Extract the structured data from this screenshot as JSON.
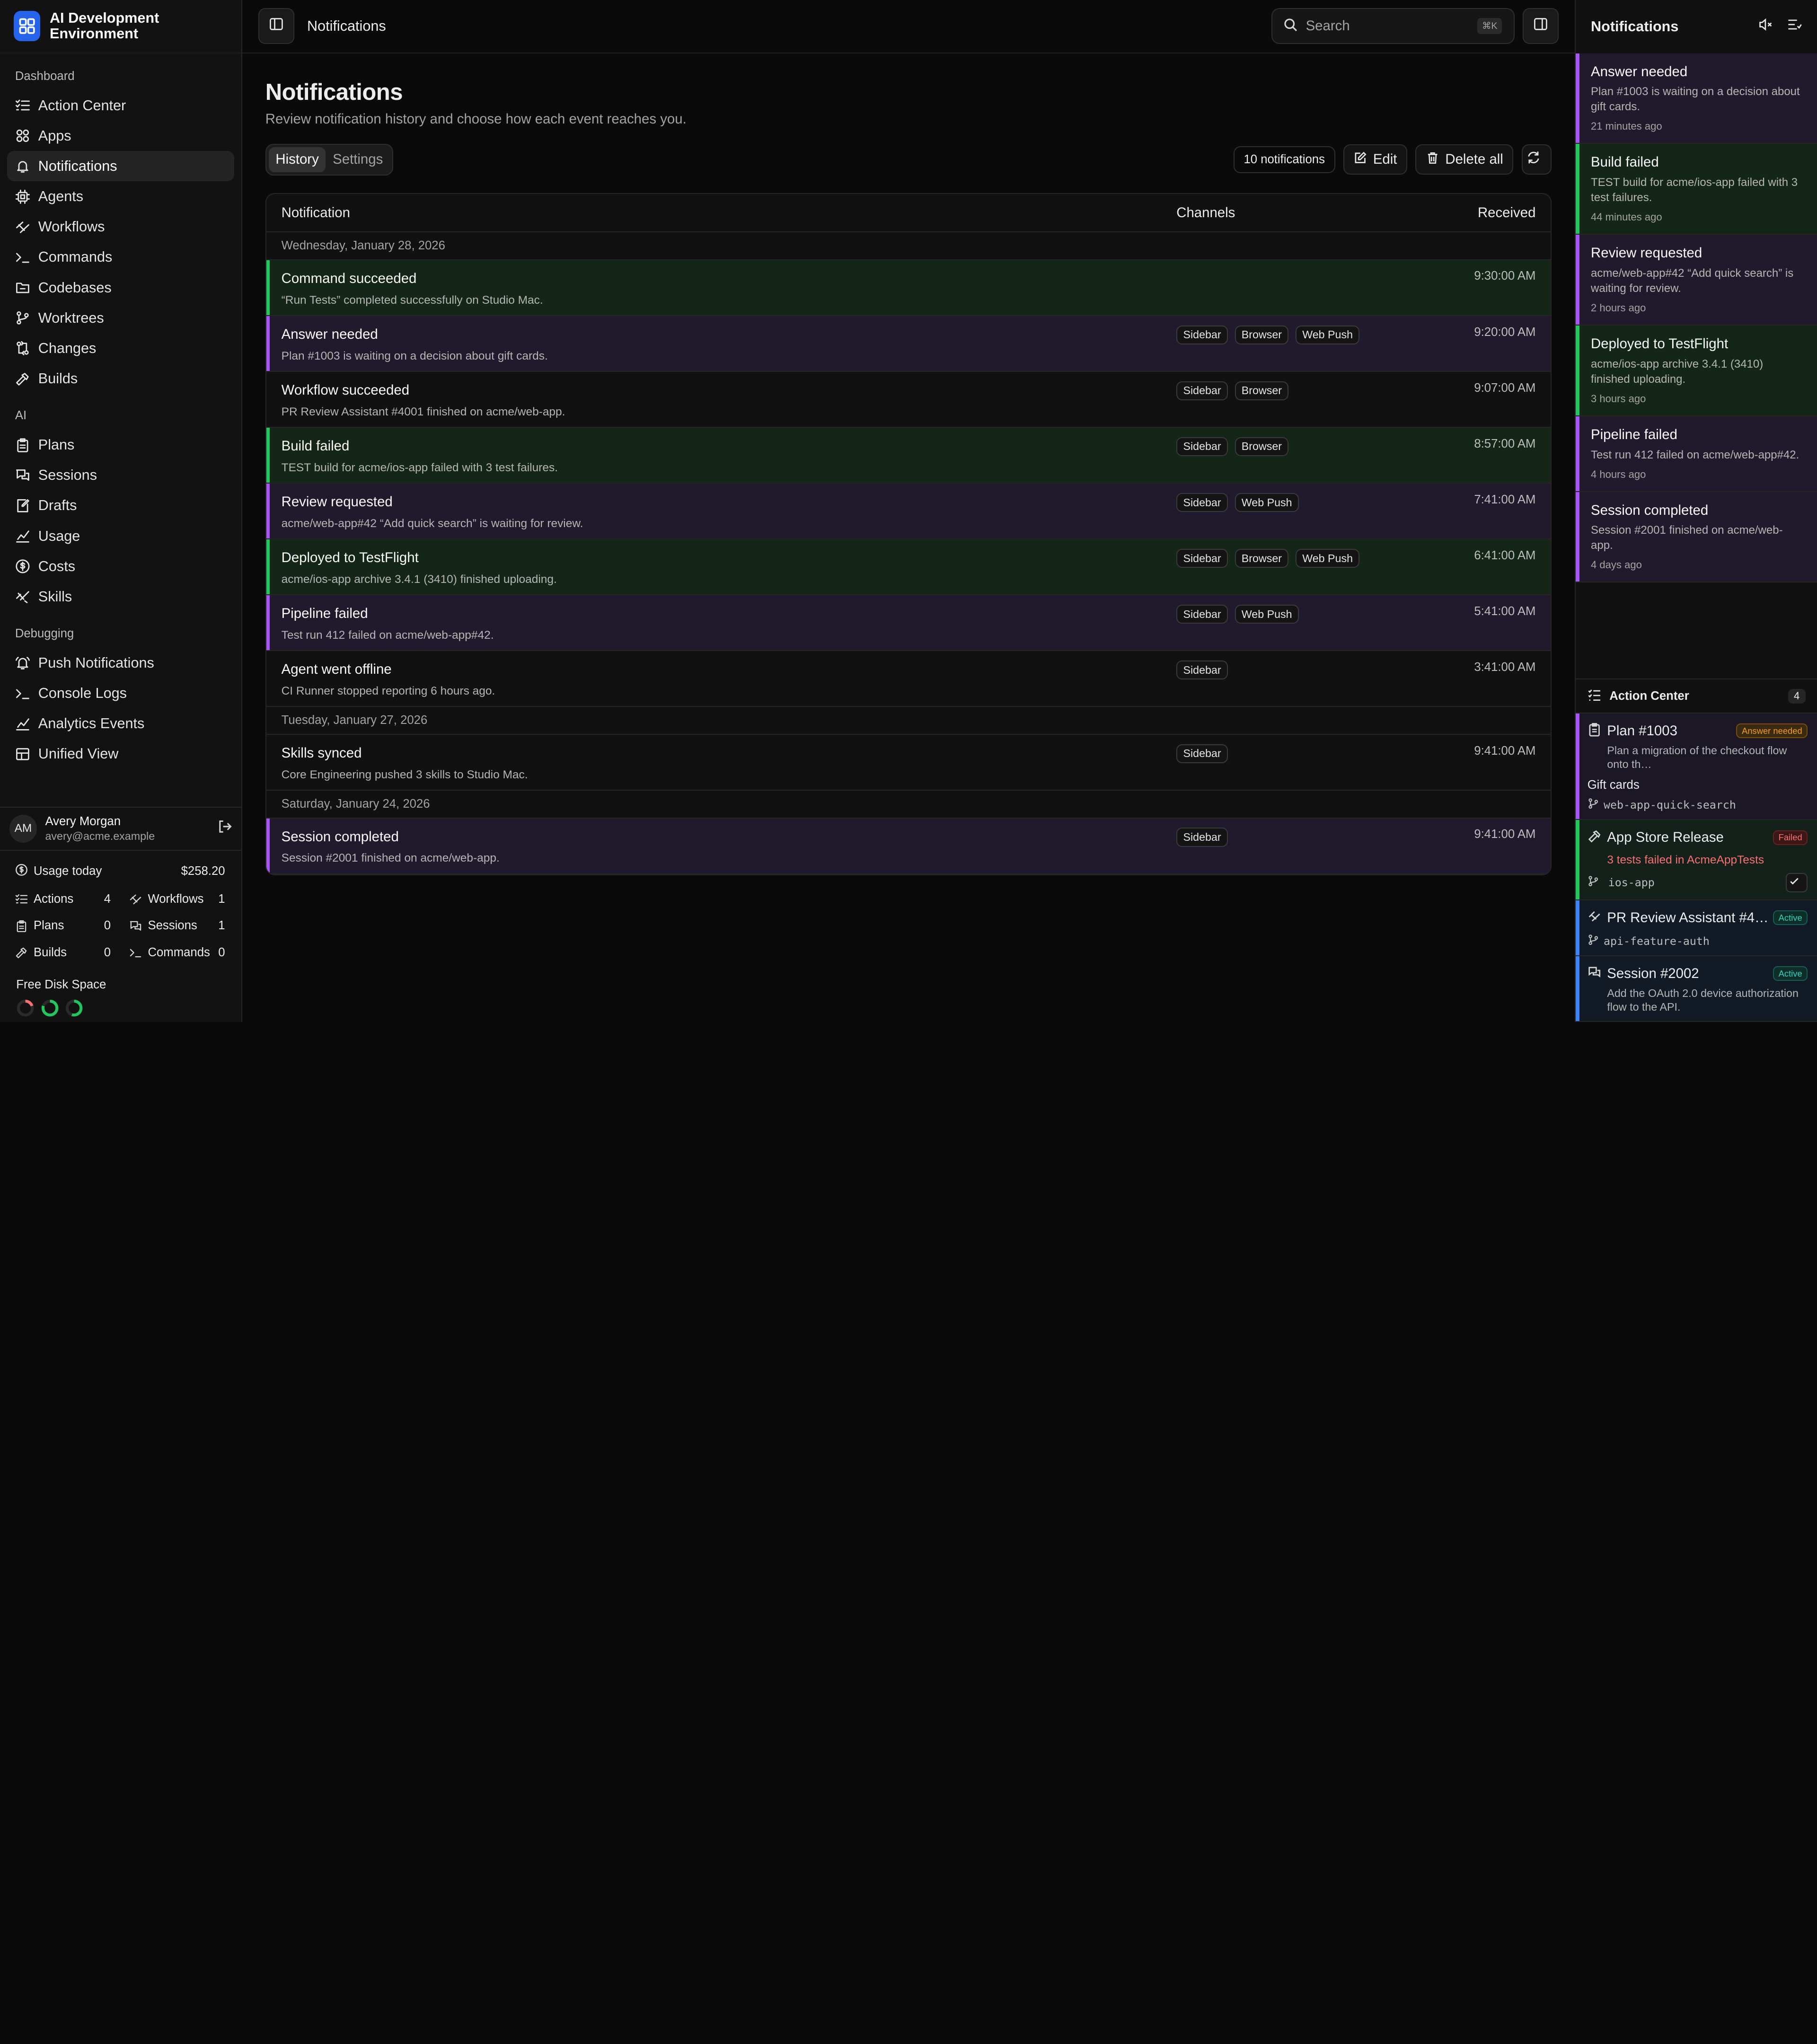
{
  "app": {
    "name": "AI Development Environment"
  },
  "sidebar": {
    "sections": [
      {
        "title": "Dashboard",
        "items": [
          {
            "label": "Action Center",
            "icon": "list-check-icon"
          },
          {
            "label": "Apps",
            "icon": "apps-icon"
          },
          {
            "label": "Notifications",
            "icon": "bell-icon",
            "active": true
          },
          {
            "label": "Agents",
            "icon": "cpu-icon"
          },
          {
            "label": "Workflows",
            "icon": "workflow-icon"
          },
          {
            "label": "Commands",
            "icon": "terminal-icon"
          },
          {
            "label": "Codebases",
            "icon": "folder-icon"
          },
          {
            "label": "Worktrees",
            "icon": "branch-icon"
          },
          {
            "label": "Changes",
            "icon": "diff-icon"
          },
          {
            "label": "Builds",
            "icon": "hammer-icon"
          }
        ]
      },
      {
        "title": "AI",
        "items": [
          {
            "label": "Plans",
            "icon": "clipboard-icon"
          },
          {
            "label": "Sessions",
            "icon": "chat-icon"
          },
          {
            "label": "Drafts",
            "icon": "draft-icon"
          },
          {
            "label": "Usage",
            "icon": "chart-icon"
          },
          {
            "label": "Costs",
            "icon": "dollar-icon"
          },
          {
            "label": "Skills",
            "icon": "sparkle-icon"
          }
        ]
      },
      {
        "title": "Debugging",
        "items": [
          {
            "label": "Push Notifications",
            "icon": "bell-ring-icon"
          },
          {
            "label": "Console Logs",
            "icon": "terminal-icon"
          },
          {
            "label": "Analytics Events",
            "icon": "chart-icon"
          },
          {
            "label": "Unified View",
            "icon": "layout-icon"
          }
        ]
      }
    ],
    "user": {
      "initials": "AM",
      "name": "Avery Morgan",
      "email": "avery@acme.example"
    },
    "usage": {
      "label": "Usage today",
      "value": "$258.20"
    },
    "stats": [
      {
        "label": "Actions",
        "value": "4",
        "icon": "list-check-icon"
      },
      {
        "label": "Workflows",
        "value": "1",
        "icon": "workflow-icon"
      },
      {
        "label": "Plans",
        "value": "0",
        "icon": "clipboard-icon"
      },
      {
        "label": "Sessions",
        "value": "1",
        "icon": "chat-icon"
      },
      {
        "label": "Builds",
        "value": "0",
        "icon": "hammer-icon"
      },
      {
        "label": "Commands",
        "value": "0",
        "icon": "terminal-icon"
      }
    ],
    "disk": {
      "title": "Free Disk Space",
      "rings": [
        {
          "color": "#f87171",
          "fraction": 0.2
        },
        {
          "color": "#22c55e",
          "fraction": 0.8
        },
        {
          "color": "#22c55e",
          "fraction": 0.55
        }
      ]
    }
  },
  "topbar": {
    "title": "Notifications",
    "search_placeholder": "Search",
    "shortcut": "⌘K"
  },
  "page": {
    "title": "Notifications",
    "subtitle": "Review notification history and choose how each event reaches you.",
    "tabs": [
      {
        "label": "History",
        "active": true
      },
      {
        "label": "Settings",
        "active": false
      }
    ],
    "count": "10 notifications",
    "edit_label": "Edit",
    "delete_label": "Delete all"
  },
  "table": {
    "headers": {
      "notification": "Notification",
      "channels": "Channels",
      "received": "Received"
    },
    "groups": [
      {
        "date": "Wednesday, January 28, 2026",
        "rows": [
          {
            "title": "Command succeeded",
            "desc": "“Run Tests” completed successfully on Studio Mac.",
            "channels": [],
            "time": "9:30:00 AM",
            "tone": "green"
          },
          {
            "title": "Answer needed",
            "desc": "Plan #1003 is waiting on a decision about gift cards.",
            "channels": [
              "Sidebar",
              "Browser",
              "Web Push"
            ],
            "time": "9:20:00 AM",
            "tone": "purple"
          },
          {
            "title": "Workflow succeeded",
            "desc": "PR Review Assistant #4001 finished on acme/web-app.",
            "channels": [
              "Sidebar",
              "Browser"
            ],
            "time": "9:07:00 AM",
            "tone": "none"
          },
          {
            "title": "Build failed",
            "desc": "TEST build for acme/ios-app failed with 3 test failures.",
            "channels": [
              "Sidebar",
              "Browser"
            ],
            "time": "8:57:00 AM",
            "tone": "green"
          },
          {
            "title": "Review requested",
            "desc": "acme/web-app#42 “Add quick search” is waiting for review.",
            "channels": [
              "Sidebar",
              "Web Push"
            ],
            "time": "7:41:00 AM",
            "tone": "purple"
          },
          {
            "title": "Deployed to TestFlight",
            "desc": "acme/ios-app archive 3.4.1 (3410) finished uploading.",
            "channels": [
              "Sidebar",
              "Browser",
              "Web Push"
            ],
            "time": "6:41:00 AM",
            "tone": "green"
          },
          {
            "title": "Pipeline failed",
            "desc": "Test run 412 failed on acme/web-app#42.",
            "channels": [
              "Sidebar",
              "Web Push"
            ],
            "time": "5:41:00 AM",
            "tone": "purple"
          },
          {
            "title": "Agent went offline",
            "desc": "CI Runner stopped reporting 6 hours ago.",
            "channels": [
              "Sidebar"
            ],
            "time": "3:41:00 AM",
            "tone": "none"
          }
        ]
      },
      {
        "date": "Tuesday, January 27, 2026",
        "rows": [
          {
            "title": "Skills synced",
            "desc": "Core Engineering pushed 3 skills to Studio Mac.",
            "channels": [
              "Sidebar"
            ],
            "time": "9:41:00 AM",
            "tone": "none"
          }
        ]
      },
      {
        "date": "Saturday, January 24, 2026",
        "rows": [
          {
            "title": "Session completed",
            "desc": "Session #2001 finished on acme/web-app.",
            "channels": [
              "Sidebar"
            ],
            "time": "9:41:00 AM",
            "tone": "purple"
          }
        ]
      }
    ]
  },
  "rpanel": {
    "title": "Notifications",
    "items": [
      {
        "title": "Answer needed",
        "desc": "Plan #1003 is waiting on a decision about gift cards.",
        "time": "21 minutes ago",
        "tone": "purple"
      },
      {
        "title": "Build failed",
        "desc": "TEST build for acme/ios-app failed with 3 test failures.",
        "time": "44 minutes ago",
        "tone": "green"
      },
      {
        "title": "Review requested",
        "desc": "acme/web-app#42 “Add quick search” is waiting for review.",
        "time": "2 hours ago",
        "tone": "purple"
      },
      {
        "title": "Deployed to TestFlight",
        "desc": "acme/ios-app archive 3.4.1 (3410) finished uploading.",
        "time": "3 hours ago",
        "tone": "green"
      },
      {
        "title": "Pipeline failed",
        "desc": "Test run 412 failed on acme/web-app#42.",
        "time": "4 hours ago",
        "tone": "purple"
      },
      {
        "title": "Session completed",
        "desc": "Session #2001 finished on acme/web-app.",
        "time": "4 days ago",
        "tone": "purple"
      }
    ],
    "action_center": {
      "title": "Action Center",
      "count": "4",
      "plan": {
        "name": "Plan #1003",
        "badge": "Answer needed",
        "desc": "Plan a migration of the checkout flow onto th…",
        "sub": "Gift cards",
        "branch": "web-app-quick-search"
      },
      "release": {
        "name": "App Store Release",
        "badge": "Failed",
        "error": "3 tests failed in AcmeAppTests",
        "branch": "ios-app"
      },
      "review": {
        "name": "PR Review Assistant #4…",
        "badge": "Active",
        "branch": "api-feature-auth"
      },
      "session": {
        "name": "Session #2002",
        "badge": "Active",
        "desc": "Add the OAuth 2.0 device authorization flow to the API."
      }
    }
  }
}
